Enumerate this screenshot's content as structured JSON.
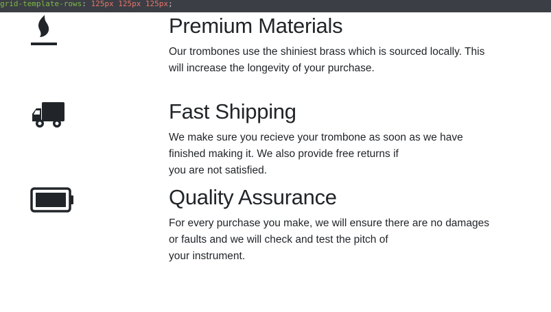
{
  "code_bar": {
    "property": "grid-template-rows",
    "separator": ":",
    "value": " 125px 125px 125px",
    "terminator": ";"
  },
  "features": [
    {
      "icon": "fire-icon",
      "title": "Premium Materials",
      "lines": [
        "Our trombones use the shiniest brass which is sourced locally. This",
        "will increase the longevity of your purchase."
      ]
    },
    {
      "icon": "truck-icon",
      "title": "Fast Shipping",
      "lines": [
        "We make sure you recieve your trombone as soon as we have",
        "finished making it. We also provide free returns if",
        "you are not satisfied."
      ]
    },
    {
      "icon": "battery-full-icon",
      "title": "Quality Assurance",
      "lines": [
        "For every purchase you make, we will ensure there are no damages",
        "or faults and we will check and test the pitch of",
        "your instrument."
      ]
    }
  ],
  "colors": {
    "text": "#212529",
    "code_background": "#3b3e44",
    "code_property": "#7fb947",
    "code_value": "#e8746a"
  }
}
